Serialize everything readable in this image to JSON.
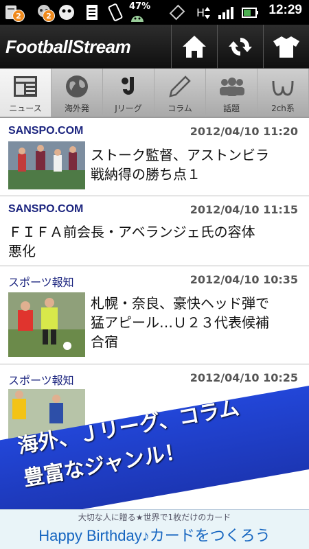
{
  "status_bar": {
    "badges": [
      "2",
      "2"
    ],
    "battery_percent": "47%",
    "time": "12:29"
  },
  "app": {
    "logo": "FootballStream"
  },
  "header_buttons": [
    {
      "icon": "home-icon"
    },
    {
      "icon": "refresh-icon"
    },
    {
      "icon": "jersey-icon"
    }
  ],
  "tabs": [
    {
      "label": "ニュース",
      "icon": "newspaper-icon",
      "active": true
    },
    {
      "label": "海外発",
      "icon": "globe-icon",
      "active": false
    },
    {
      "label": "Jリーグ",
      "icon": "jleague-icon",
      "active": false
    },
    {
      "label": "コラム",
      "icon": "pencil-icon",
      "active": false
    },
    {
      "label": "話題",
      "icon": "people-icon",
      "active": false
    },
    {
      "label": "2ch系",
      "icon": "omega-icon",
      "active": false
    }
  ],
  "news": [
    {
      "source": "SANSPO.COM",
      "datetime": "2012/04/10 11:20",
      "headline_lines": [
        "ストーク監督、アストンビラ",
        "戦納得の勝ち点１"
      ],
      "has_thumb": true
    },
    {
      "source": "SANSPO.COM",
      "datetime": "2012/04/10 11:15",
      "headline_lines": [
        "ＦＩＦＡ前会長・アベランジェ氏の容体",
        "悪化"
      ],
      "has_thumb": false
    },
    {
      "source": "スポーツ報知",
      "datetime": "2012/04/10 10:35",
      "headline_lines": [
        "札幌・奈良、豪快ヘッド弾で",
        "猛アピール…Ｕ２３代表候補",
        "合宿"
      ],
      "has_thumb": true
    },
    {
      "source": "スポーツ報知",
      "datetime": "2012/04/10 10:25",
      "headline_lines": [],
      "has_thumb": true
    }
  ],
  "promo": {
    "line1": "海外、Ｊリーグ、コラム",
    "line2": "豊富なジャンル！"
  },
  "ad": {
    "top_text": "大切な人に贈る★世界で1枚だけのカード",
    "main_text": "Happy Birthday♪カードをつくろう"
  },
  "colors": {
    "promo_blue": "#2246d8",
    "source_color": "#1a237e",
    "ad_text": "#1565c0"
  }
}
